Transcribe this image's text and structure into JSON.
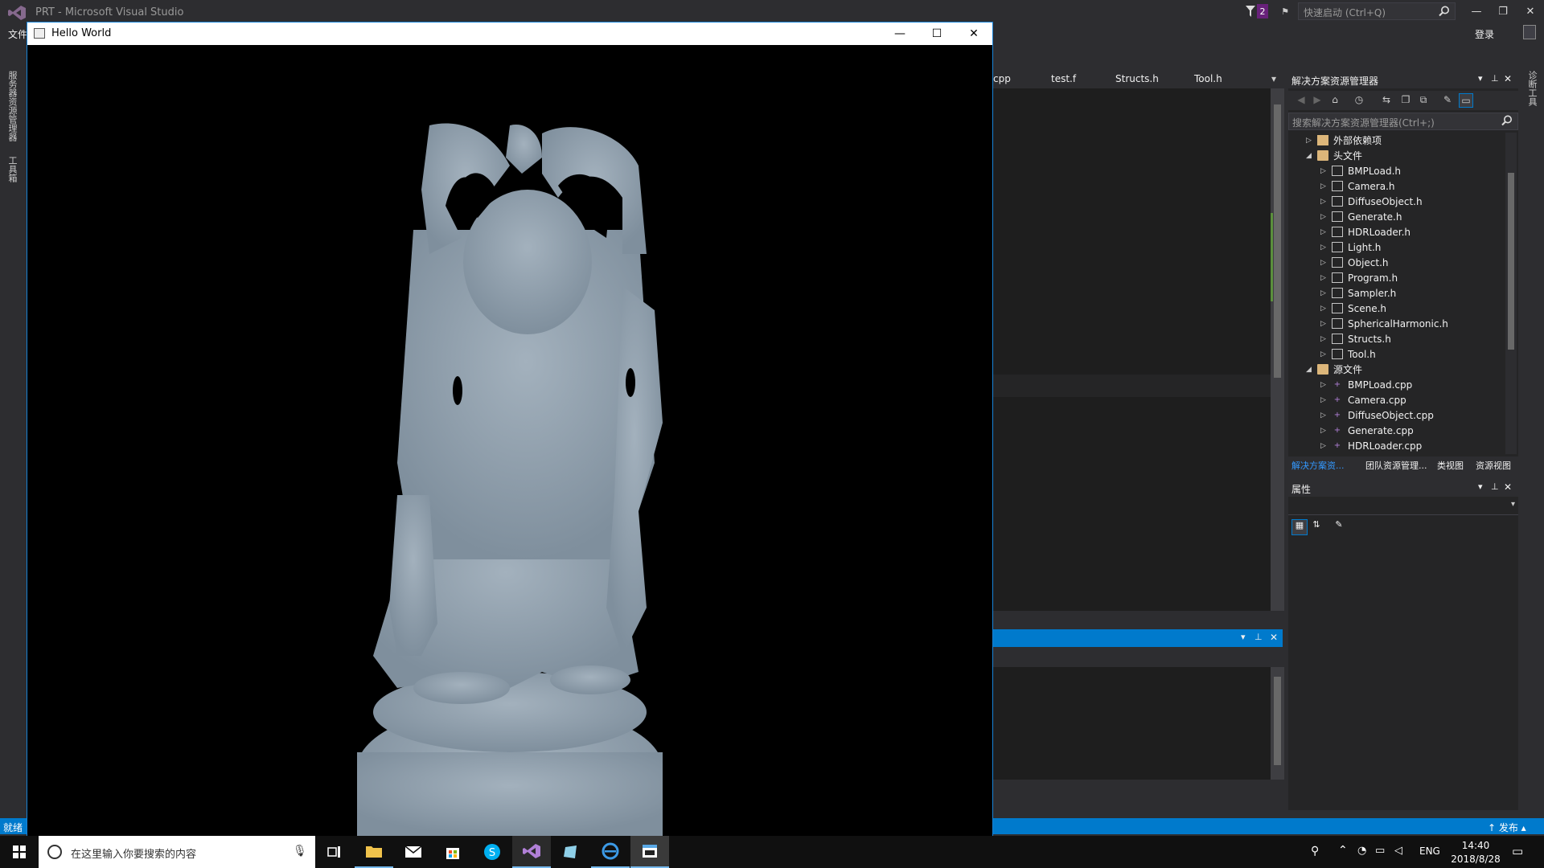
{
  "vs": {
    "title": "PRT - Microsoft Visual Studio",
    "notification_count": "2",
    "quick_launch_placeholder": "快速启动 (Ctrl+Q)",
    "menu_file": "文件",
    "sign_in": "登录",
    "left_strip": [
      "服务器资源管理器",
      "工具箱"
    ],
    "right_strip": "诊断工具",
    "tabs": [
      "cpp",
      "test.f",
      "Structs.h",
      "Tool.h"
    ],
    "solution_explorer": {
      "title": "解决方案资源管理器",
      "search_placeholder": "搜索解决方案资源管理器(Ctrl+;)",
      "tree": [
        {
          "label": "外部依赖项",
          "type": "ext",
          "indent": 1,
          "expander": "▷"
        },
        {
          "label": "头文件",
          "type": "folder",
          "indent": 1,
          "expander": "◢"
        },
        {
          "label": "BMPLoad.h",
          "type": "h",
          "indent": 2,
          "expander": "▷"
        },
        {
          "label": "Camera.h",
          "type": "h",
          "indent": 2,
          "expander": "▷"
        },
        {
          "label": "DiffuseObject.h",
          "type": "h",
          "indent": 2,
          "expander": "▷"
        },
        {
          "label": "Generate.h",
          "type": "h",
          "indent": 2,
          "expander": "▷"
        },
        {
          "label": "HDRLoader.h",
          "type": "h",
          "indent": 2,
          "expander": "▷"
        },
        {
          "label": "Light.h",
          "type": "h",
          "indent": 2,
          "expander": "▷"
        },
        {
          "label": "Object.h",
          "type": "h",
          "indent": 2,
          "expander": "▷"
        },
        {
          "label": "Program.h",
          "type": "h",
          "indent": 2,
          "expander": "▷"
        },
        {
          "label": "Sampler.h",
          "type": "h",
          "indent": 2,
          "expander": "▷"
        },
        {
          "label": "Scene.h",
          "type": "h",
          "indent": 2,
          "expander": "▷"
        },
        {
          "label": "SphericalHarmonic.h",
          "type": "h",
          "indent": 2,
          "expander": "▷"
        },
        {
          "label": "Structs.h",
          "type": "h",
          "indent": 2,
          "expander": "▷"
        },
        {
          "label": "Tool.h",
          "type": "h",
          "indent": 2,
          "expander": "▷"
        },
        {
          "label": "源文件",
          "type": "folder",
          "indent": 1,
          "expander": "◢"
        },
        {
          "label": "BMPLoad.cpp",
          "type": "cpp",
          "indent": 2,
          "expander": "▷"
        },
        {
          "label": "Camera.cpp",
          "type": "cpp",
          "indent": 2,
          "expander": "▷"
        },
        {
          "label": "DiffuseObject.cpp",
          "type": "cpp",
          "indent": 2,
          "expander": "▷"
        },
        {
          "label": "Generate.cpp",
          "type": "cpp",
          "indent": 2,
          "expander": "▷"
        },
        {
          "label": "HDRLoader.cpp",
          "type": "cpp",
          "indent": 2,
          "expander": "▷"
        }
      ],
      "bottom_tabs": [
        "解决方案资...",
        "团队资源管理...",
        "类视图",
        "资源视图"
      ]
    },
    "properties": {
      "title": "属性"
    },
    "status": {
      "ready": "就绪",
      "publish": "↑ 发布 ▴"
    }
  },
  "hello_window": {
    "title": "Hello World"
  },
  "taskbar": {
    "search_placeholder": "在这里输入你要搜索的内容",
    "lang": "ENG",
    "time": "14:40",
    "date": "2018/8/28"
  },
  "colors": {
    "accent": "#007acc",
    "statue": "#8a9aa8",
    "vs_bg": "#2d2d30"
  }
}
